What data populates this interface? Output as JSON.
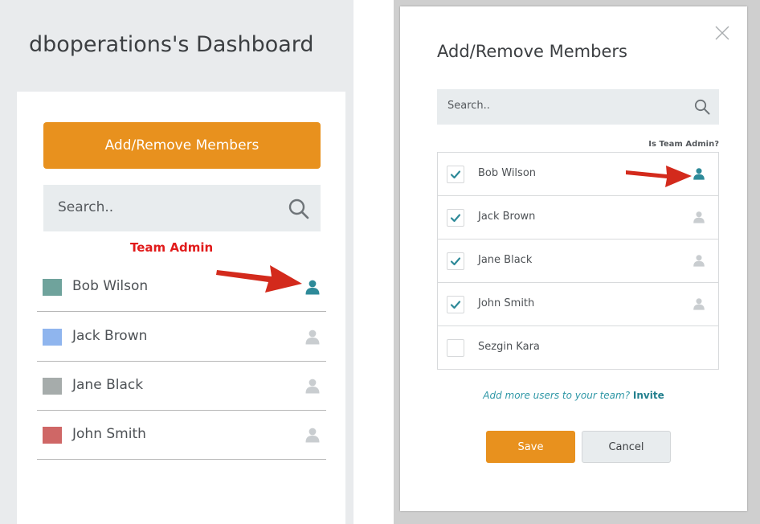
{
  "dashboard": {
    "title": "dboperations's Dashboard",
    "add_remove_button": "Add/Remove Members",
    "search_placeholder": "Search..",
    "team_admin_callout": "Team Admin",
    "members": [
      {
        "name": "Bob Wilson",
        "swatch": "#6fa39c",
        "is_admin": true
      },
      {
        "name": "Jack Brown",
        "swatch": "#8fb5ee",
        "is_admin": false
      },
      {
        "name": "Jane Black",
        "swatch": "#a6acab",
        "is_admin": false
      },
      {
        "name": "John Smith",
        "swatch": "#cf6766",
        "is_admin": false
      }
    ]
  },
  "modal": {
    "title": "Add/Remove Members",
    "search_placeholder": "Search..",
    "admin_header": "Is Team Admin?",
    "members": [
      {
        "name": "Bob Wilson",
        "checked": true,
        "is_admin": true
      },
      {
        "name": "Jack Brown",
        "checked": true,
        "is_admin": false
      },
      {
        "name": "Jane Black",
        "checked": true,
        "is_admin": false
      },
      {
        "name": "John Smith",
        "checked": true,
        "is_admin": false
      },
      {
        "name": "Sezgin Kara",
        "checked": false,
        "is_admin": false
      }
    ],
    "invite_prompt": "Add more users to your team?",
    "invite_link": "Invite",
    "save_label": "Save",
    "cancel_label": "Cancel"
  },
  "colors": {
    "accent_orange": "#e8911e",
    "admin_teal": "#2e8a99",
    "inactive_icon": "#c9cdd0",
    "callout_red": "#e11b1b"
  },
  "icons": {
    "search": "search-icon",
    "admin": "person-icon",
    "close": "close-icon",
    "check": "check-icon"
  }
}
